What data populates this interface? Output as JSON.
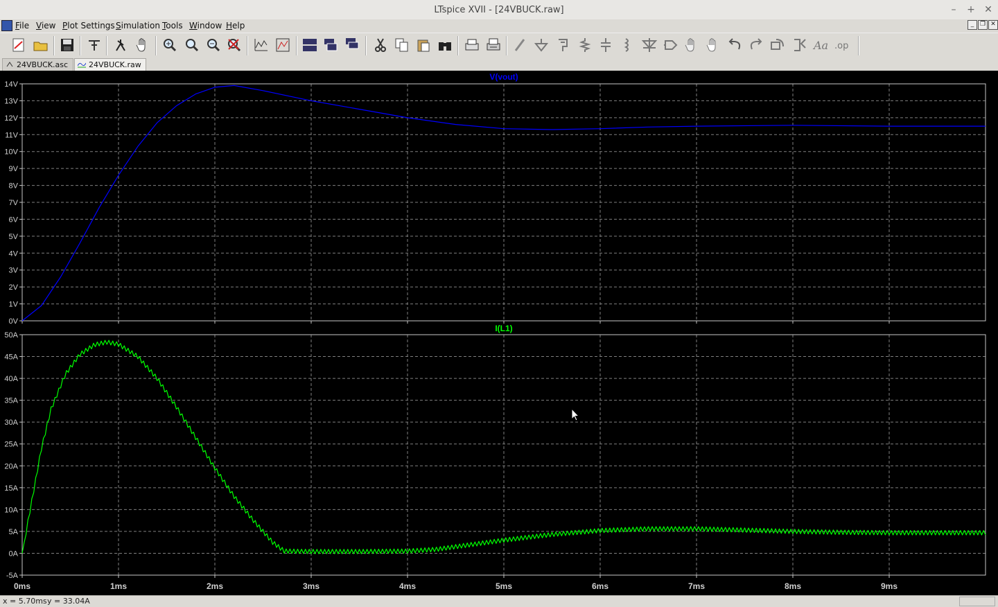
{
  "window": {
    "title": "LTspice XVII - [24VBUCK.raw]"
  },
  "menu": [
    {
      "label": "File",
      "ul": "F",
      "rest": "ile"
    },
    {
      "label": "View",
      "ul": "V",
      "rest": "iew"
    },
    {
      "label": "Plot Settings",
      "ul": "P",
      "rest": "lot Settings"
    },
    {
      "label": "Simulation",
      "ul": "S",
      "rest": "imulation"
    },
    {
      "label": "Tools",
      "ul": "T",
      "rest": "ools"
    },
    {
      "label": "Window",
      "ul": "W",
      "rest": "indow"
    },
    {
      "label": "Help",
      "ul": "H",
      "rest": "elp"
    }
  ],
  "toolbar": [
    "new-schematic",
    "open",
    "save",
    "control-panel",
    "run",
    "halt",
    "zoom-in",
    "zoom-pan",
    "zoom-out",
    "zoom-fit",
    "autorange",
    "mark-unmark",
    "tile-horizontal",
    "tile-vertical",
    "cascade",
    "cut",
    "copy",
    "paste",
    "find",
    "print",
    "print-setup",
    "draw-wire",
    "ground",
    "label-net",
    "resistor",
    "capacitor",
    "inductor",
    "diode",
    "component",
    "move",
    "drag",
    "undo",
    "redo",
    "rotate",
    "mirror",
    "text",
    "spice-directive"
  ],
  "tabs": [
    {
      "label": "24VBUCK.asc",
      "icon": "schematic-icon",
      "active": false
    },
    {
      "label": "24VBUCK.raw",
      "icon": "waveform-icon",
      "active": true
    }
  ],
  "status": {
    "x_readout": "x = 5.70ms",
    "y_readout": "y = 33.04A"
  },
  "chart_data": [
    {
      "type": "line",
      "title": "V(vout)",
      "color": "#0000ff",
      "xlim": [
        0,
        10
      ],
      "x_ticks": [
        "0ms",
        "1ms",
        "2ms",
        "3ms",
        "4ms",
        "5ms",
        "6ms",
        "7ms",
        "8ms",
        "9ms"
      ],
      "ylim": [
        0,
        14
      ],
      "y_ticks": [
        "0V",
        "1V",
        "2V",
        "3V",
        "4V",
        "5V",
        "6V",
        "7V",
        "8V",
        "9V",
        "10V",
        "11V",
        "12V",
        "13V",
        "14V"
      ],
      "grid": true,
      "points": [
        [
          0,
          0
        ],
        [
          0.2,
          0.9
        ],
        [
          0.4,
          2.6
        ],
        [
          0.6,
          4.6
        ],
        [
          0.8,
          6.7
        ],
        [
          1.0,
          8.6
        ],
        [
          1.2,
          10.3
        ],
        [
          1.4,
          11.7
        ],
        [
          1.6,
          12.7
        ],
        [
          1.8,
          13.4
        ],
        [
          2.0,
          13.8
        ],
        [
          2.2,
          13.9
        ],
        [
          2.5,
          13.6
        ],
        [
          3.0,
          13.0
        ],
        [
          3.5,
          12.5
        ],
        [
          4.0,
          12.0
        ],
        [
          4.5,
          11.6
        ],
        [
          5.0,
          11.35
        ],
        [
          5.5,
          11.3
        ],
        [
          6.0,
          11.35
        ],
        [
          6.5,
          11.45
        ],
        [
          7.0,
          11.5
        ],
        [
          8.0,
          11.55
        ],
        [
          9.0,
          11.5
        ],
        [
          10.0,
          11.5
        ]
      ]
    },
    {
      "type": "line",
      "title": "I(L1)",
      "color": "#00ff00",
      "xlim": [
        0,
        10
      ],
      "x_ticks": [
        "0ms",
        "1ms",
        "2ms",
        "3ms",
        "4ms",
        "5ms",
        "6ms",
        "7ms",
        "8ms",
        "9ms"
      ],
      "ylim": [
        -5,
        50
      ],
      "y_ticks": [
        "-5A",
        "0A",
        "5A",
        "10A",
        "15A",
        "20A",
        "25A",
        "30A",
        "35A",
        "40A",
        "45A",
        "50A"
      ],
      "grid": true,
      "ripple_amplitude": 0.5,
      "points": [
        [
          0,
          0
        ],
        [
          0.1,
          12
        ],
        [
          0.2,
          24
        ],
        [
          0.3,
          33
        ],
        [
          0.45,
          41
        ],
        [
          0.6,
          45.5
        ],
        [
          0.75,
          47.7
        ],
        [
          0.88,
          48.3
        ],
        [
          1.0,
          47.8
        ],
        [
          1.2,
          45
        ],
        [
          1.4,
          40
        ],
        [
          1.6,
          33.5
        ],
        [
          1.8,
          26.5
        ],
        [
          2.0,
          19.5
        ],
        [
          2.2,
          13
        ],
        [
          2.4,
          7.5
        ],
        [
          2.6,
          2.5
        ],
        [
          2.72,
          0.5
        ],
        [
          3.0,
          0.4
        ],
        [
          3.5,
          0.4
        ],
        [
          4.0,
          0.5
        ],
        [
          4.3,
          0.9
        ],
        [
          4.6,
          1.8
        ],
        [
          5.0,
          3.0
        ],
        [
          5.5,
          4.3
        ],
        [
          6.0,
          5.2
        ],
        [
          6.5,
          5.6
        ],
        [
          7.0,
          5.6
        ],
        [
          7.5,
          5.3
        ],
        [
          8.0,
          5.0
        ],
        [
          8.5,
          4.8
        ],
        [
          9.0,
          4.7
        ],
        [
          10.0,
          4.7
        ]
      ]
    }
  ]
}
